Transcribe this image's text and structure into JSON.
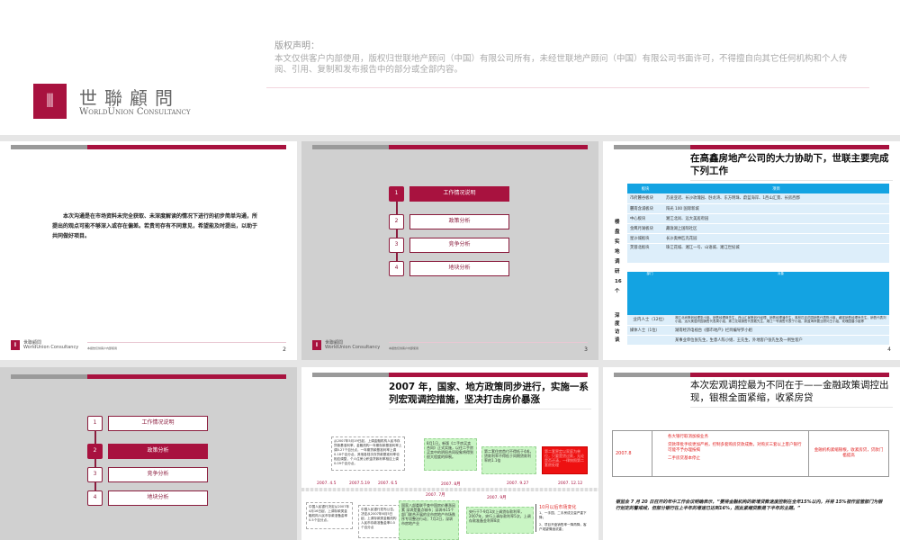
{
  "slide1": {
    "copyright_heading": "版权声明：",
    "copyright_text": "本文仅供客户内部使用，版权归世联地产顾问（中国）有限公司所有，未经世联地产顾问（中国）有限公司书面许可，不得擅自向其它任何机构和个人传阅、引用、复制和发布报告中的部分或全部内容。",
    "logo_cn": "世聯顧問",
    "logo_en": "WorldUnion Consultancy"
  },
  "footer": {
    "logo_cn": "世聯顧問",
    "logo_en": "WorldUnion Consultancy",
    "note": "本报告仅供客户内部使用"
  },
  "slide2": {
    "text": "本次沟通是在市场资料未完全获取、未深度解读的情况下进行的初步简单沟通，所提出的观点可能不够深入或存在偏差。若贵司存有不同意见，希望能及时提出，以助于共同做好项目。",
    "page": "2"
  },
  "toc": {
    "items": [
      {
        "num": "1",
        "label": "工作情况说明"
      },
      {
        "num": "2",
        "label": "政策分析"
      },
      {
        "num": "3",
        "label": "竞争分析"
      },
      {
        "num": "4",
        "label": "地块分析"
      }
    ]
  },
  "slide3": {
    "page": "3",
    "active": 1
  },
  "slide4": {
    "title": "在高鑫房地产公司的大力协助下，世联主要完成下列工作",
    "section1_label": "楼盘实地调研16个",
    "table1_headers": [
      "板块",
      "项目"
    ],
    "table1_rows": [
      [
        "市府麓谷板块",
        "苏迪亚诺、长沙玫瑰园、卧龙湾、东方明珠、蔚蓝海岸、1西山汇景、长房西郡"
      ],
      [
        "麓南含浦板块",
        "阳光 100 国际新城"
      ],
      [
        "中心板块",
        "湘江北尚、远大美居府园"
      ],
      [
        "金鹰月湖板块",
        "藏珑湖上国际社区"
      ],
      [
        "星沙城板块",
        "长沙奥林匹克花园"
      ],
      [
        "芙蓉北板块",
        "珠江花城、湘江一号、山语城、湘江世纪城"
      ]
    ],
    "section2_label": "深度访谈",
    "table2_headers": [
      "部门",
      "对象"
    ],
    "table2_rows": [
      [
        "业内人士（12位）",
        "湘江北尚策划经理张小姐、销售经理蒋先生，西山汇景策划代经理、销售经理潘先生，奥林匹克花园销售代表陈小姐，藏珑销售经理肖先生、销售代表刘小姐，远大美居府园销售代表周小姐，珠江花城销售代表戴先生，湘江一号销售代表宁小姐，蔚蓝海岸置业顾问王小姐，玫瑰园唐小姐等"
      ],
      [
        "媒体人士（1位）",
        "湖南经济电视台《都市地产》栏目编导罗小姐"
      ],
      [
        "",
        "某事业单位张先生，生意人陈小姐、王先生，外地客户张先生及一例生客户"
      ]
    ],
    "page": "4"
  },
  "slide5": {
    "active": 2
  },
  "slide6": {
    "title": "2007 年，国家、地方政策同步进行，实施一系列宏观调控措施，坚决打击房价暴涨",
    "dates_top": [
      "2007. 4.5",
      "2007.5.19",
      "2007. 6.5",
      "2007. 8月",
      "2007. 9.27",
      "2007. 12.12"
    ],
    "dates_bottom": [
      "2007. 7月",
      "2007. 9月"
    ],
    "boxes_top": [
      "从2007年5月19日起，上调金融机构人民币存贷款基准利率，金融机构一年期存款基准利率上调0.27个百分点，一年期贷款基准利率上调0.18个百分点。其他各档次存贷款基准利率也相应调整，个人住房公积金贷款利率相应上调0.09个百分点。",
      "8月1日，新版《二手房买卖合同》正式实施，以往二手房买卖中的阴阳合同现象将得到很大程度的抑制。",
      "第二套住房首付不得低于4成，贷款利率不得低于同期贷款利率的1.1倍",
      "第二套界定以家庭为单位，只要是贷过款，无论是否还清，一律按照第二套房处理"
    ],
    "boxes_bottom": [
      "中国人民银行决定从2007年4月16日起，上调存款类金融机构人民币存款准备金率0.5个百分点。",
      "中国人民银行发布公告，决定从2007年6月5日起，上调存款类金融机构人民币存款准备金率0.5个百分点",
      "国家八部委联手查中国房价暴涨因素 深圳是重点城市；深圳市15个部门联合开展的全市房地产市场秩序专项整治行动；7月2日，深圳市房地产业",
      "央行于7-9月3次上调贷存款利率，2007年，央行上调存款利率5次，上调存款准备金利率8次"
    ],
    "side_title": "10月以后市场变化",
    "side_items": [
      "1、一手园、二手房成交量严重下降；",
      "2、项目开盘销售率一降再降，客户观望情绪浓重；"
    ]
  },
  "slide7": {
    "title": "本次宏观调控最为不同在于——金融政策调控出现，银根全面紧缩，收紧房贷",
    "table": {
      "date": "2007.8",
      "bullets": [
        "各大银行取消加按业务",
        "贷款审批手续更加严格，控制多套购房贷款成数，对购买三套以上客户银行可能不予办理按揭",
        "二手房贷基本停止"
      ],
      "conclusion": "金融机构紧缩银根，收紧房贷，贷款门槛提高"
    },
    "quote": "银监会 7 月 20 日召开的年中工作会议明确表示，“要将金融机构的新增贷款速度控制在全年15%以内，并将 15%视作监管部门为银行划定的警戒线，但部分银行在上半年的增速已达到16%，因此紧缩贷款是下半年的主题。”"
  }
}
